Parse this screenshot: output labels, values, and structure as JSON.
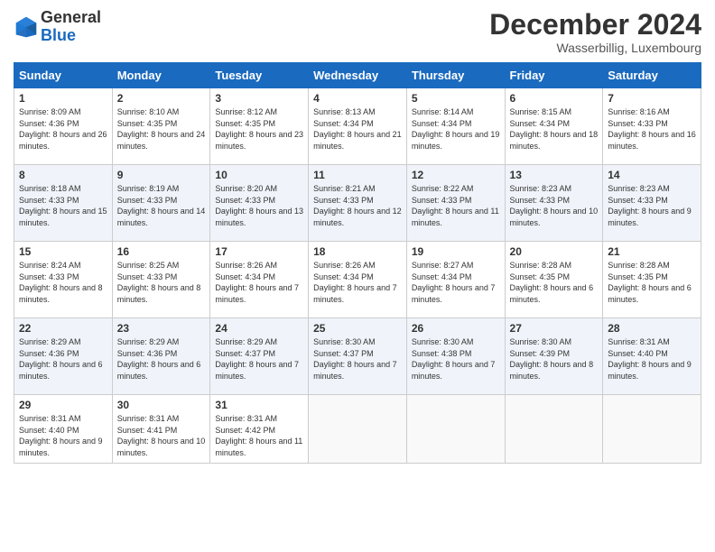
{
  "logo": {
    "general": "General",
    "blue": "Blue"
  },
  "title": "December 2024",
  "location": "Wasserbillig, Luxembourg",
  "days_header": [
    "Sunday",
    "Monday",
    "Tuesday",
    "Wednesday",
    "Thursday",
    "Friday",
    "Saturday"
  ],
  "weeks": [
    [
      {
        "day": "1",
        "sunrise": "Sunrise: 8:09 AM",
        "sunset": "Sunset: 4:36 PM",
        "daylight": "Daylight: 8 hours and 26 minutes."
      },
      {
        "day": "2",
        "sunrise": "Sunrise: 8:10 AM",
        "sunset": "Sunset: 4:35 PM",
        "daylight": "Daylight: 8 hours and 24 minutes."
      },
      {
        "day": "3",
        "sunrise": "Sunrise: 8:12 AM",
        "sunset": "Sunset: 4:35 PM",
        "daylight": "Daylight: 8 hours and 23 minutes."
      },
      {
        "day": "4",
        "sunrise": "Sunrise: 8:13 AM",
        "sunset": "Sunset: 4:34 PM",
        "daylight": "Daylight: 8 hours and 21 minutes."
      },
      {
        "day": "5",
        "sunrise": "Sunrise: 8:14 AM",
        "sunset": "Sunset: 4:34 PM",
        "daylight": "Daylight: 8 hours and 19 minutes."
      },
      {
        "day": "6",
        "sunrise": "Sunrise: 8:15 AM",
        "sunset": "Sunset: 4:34 PM",
        "daylight": "Daylight: 8 hours and 18 minutes."
      },
      {
        "day": "7",
        "sunrise": "Sunrise: 8:16 AM",
        "sunset": "Sunset: 4:33 PM",
        "daylight": "Daylight: 8 hours and 16 minutes."
      }
    ],
    [
      {
        "day": "8",
        "sunrise": "Sunrise: 8:18 AM",
        "sunset": "Sunset: 4:33 PM",
        "daylight": "Daylight: 8 hours and 15 minutes."
      },
      {
        "day": "9",
        "sunrise": "Sunrise: 8:19 AM",
        "sunset": "Sunset: 4:33 PM",
        "daylight": "Daylight: 8 hours and 14 minutes."
      },
      {
        "day": "10",
        "sunrise": "Sunrise: 8:20 AM",
        "sunset": "Sunset: 4:33 PM",
        "daylight": "Daylight: 8 hours and 13 minutes."
      },
      {
        "day": "11",
        "sunrise": "Sunrise: 8:21 AM",
        "sunset": "Sunset: 4:33 PM",
        "daylight": "Daylight: 8 hours and 12 minutes."
      },
      {
        "day": "12",
        "sunrise": "Sunrise: 8:22 AM",
        "sunset": "Sunset: 4:33 PM",
        "daylight": "Daylight: 8 hours and 11 minutes."
      },
      {
        "day": "13",
        "sunrise": "Sunrise: 8:23 AM",
        "sunset": "Sunset: 4:33 PM",
        "daylight": "Daylight: 8 hours and 10 minutes."
      },
      {
        "day": "14",
        "sunrise": "Sunrise: 8:23 AM",
        "sunset": "Sunset: 4:33 PM",
        "daylight": "Daylight: 8 hours and 9 minutes."
      }
    ],
    [
      {
        "day": "15",
        "sunrise": "Sunrise: 8:24 AM",
        "sunset": "Sunset: 4:33 PM",
        "daylight": "Daylight: 8 hours and 8 minutes."
      },
      {
        "day": "16",
        "sunrise": "Sunrise: 8:25 AM",
        "sunset": "Sunset: 4:33 PM",
        "daylight": "Daylight: 8 hours and 8 minutes."
      },
      {
        "day": "17",
        "sunrise": "Sunrise: 8:26 AM",
        "sunset": "Sunset: 4:34 PM",
        "daylight": "Daylight: 8 hours and 7 minutes."
      },
      {
        "day": "18",
        "sunrise": "Sunrise: 8:26 AM",
        "sunset": "Sunset: 4:34 PM",
        "daylight": "Daylight: 8 hours and 7 minutes."
      },
      {
        "day": "19",
        "sunrise": "Sunrise: 8:27 AM",
        "sunset": "Sunset: 4:34 PM",
        "daylight": "Daylight: 8 hours and 7 minutes."
      },
      {
        "day": "20",
        "sunrise": "Sunrise: 8:28 AM",
        "sunset": "Sunset: 4:35 PM",
        "daylight": "Daylight: 8 hours and 6 minutes."
      },
      {
        "day": "21",
        "sunrise": "Sunrise: 8:28 AM",
        "sunset": "Sunset: 4:35 PM",
        "daylight": "Daylight: 8 hours and 6 minutes."
      }
    ],
    [
      {
        "day": "22",
        "sunrise": "Sunrise: 8:29 AM",
        "sunset": "Sunset: 4:36 PM",
        "daylight": "Daylight: 8 hours and 6 minutes."
      },
      {
        "day": "23",
        "sunrise": "Sunrise: 8:29 AM",
        "sunset": "Sunset: 4:36 PM",
        "daylight": "Daylight: 8 hours and 6 minutes."
      },
      {
        "day": "24",
        "sunrise": "Sunrise: 8:29 AM",
        "sunset": "Sunset: 4:37 PM",
        "daylight": "Daylight: 8 hours and 7 minutes."
      },
      {
        "day": "25",
        "sunrise": "Sunrise: 8:30 AM",
        "sunset": "Sunset: 4:37 PM",
        "daylight": "Daylight: 8 hours and 7 minutes."
      },
      {
        "day": "26",
        "sunrise": "Sunrise: 8:30 AM",
        "sunset": "Sunset: 4:38 PM",
        "daylight": "Daylight: 8 hours and 7 minutes."
      },
      {
        "day": "27",
        "sunrise": "Sunrise: 8:30 AM",
        "sunset": "Sunset: 4:39 PM",
        "daylight": "Daylight: 8 hours and 8 minutes."
      },
      {
        "day": "28",
        "sunrise": "Sunrise: 8:31 AM",
        "sunset": "Sunset: 4:40 PM",
        "daylight": "Daylight: 8 hours and 9 minutes."
      }
    ],
    [
      {
        "day": "29",
        "sunrise": "Sunrise: 8:31 AM",
        "sunset": "Sunset: 4:40 PM",
        "daylight": "Daylight: 8 hours and 9 minutes."
      },
      {
        "day": "30",
        "sunrise": "Sunrise: 8:31 AM",
        "sunset": "Sunset: 4:41 PM",
        "daylight": "Daylight: 8 hours and 10 minutes."
      },
      {
        "day": "31",
        "sunrise": "Sunrise: 8:31 AM",
        "sunset": "Sunset: 4:42 PM",
        "daylight": "Daylight: 8 hours and 11 minutes."
      },
      null,
      null,
      null,
      null
    ]
  ]
}
